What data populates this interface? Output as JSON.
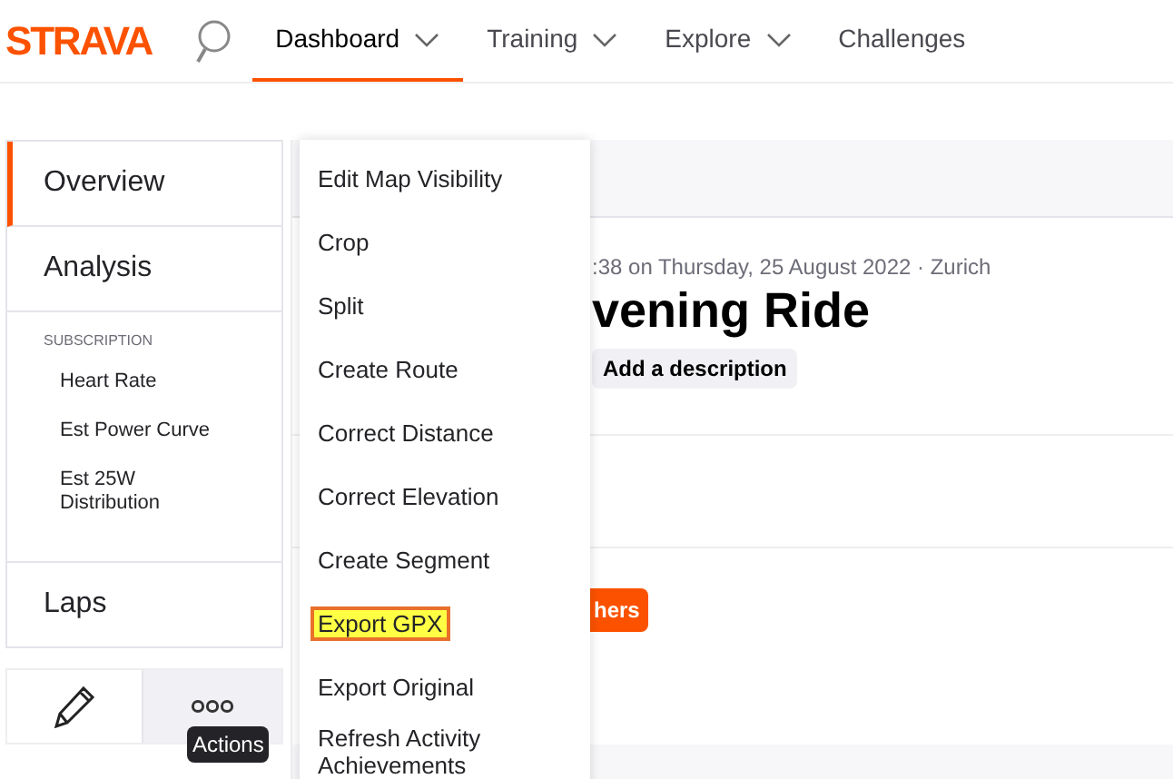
{
  "header": {
    "logo": "STRAVA",
    "nav": [
      {
        "label": "Dashboard",
        "selected": true,
        "dropdown": true
      },
      {
        "label": "Training",
        "selected": false,
        "dropdown": true
      },
      {
        "label": "Explore",
        "selected": false,
        "dropdown": true
      },
      {
        "label": "Challenges",
        "selected": false,
        "dropdown": false
      }
    ]
  },
  "sidebar": {
    "tabs": [
      {
        "label": "Overview",
        "selected": true
      },
      {
        "label": "Analysis",
        "selected": false
      }
    ],
    "section_title": "SUBSCRIPTION",
    "sub_items": [
      "Heart Rate",
      "Est Power Curve",
      "Est 25W Distribution"
    ],
    "laps": {
      "label": "Laps",
      "selected": false
    },
    "actions_tooltip": "Actions"
  },
  "actions_menu": [
    {
      "label": "Edit Map Visibility",
      "highlighted": false
    },
    {
      "label": "Crop",
      "highlighted": false
    },
    {
      "label": "Split",
      "highlighted": false
    },
    {
      "label": "Create Route",
      "highlighted": false
    },
    {
      "label": "Correct Distance",
      "highlighted": false
    },
    {
      "label": "Correct Elevation",
      "highlighted": false
    },
    {
      "label": "Create Segment",
      "highlighted": false
    },
    {
      "label": "Export GPX",
      "highlighted": true
    },
    {
      "label": "Export Original",
      "highlighted": false
    },
    {
      "label": "Refresh Activity Achievements",
      "highlighted": false
    }
  ],
  "activity": {
    "date": ":38 on Thursday, 25 August 2022 · Zurich",
    "title": "vening Ride",
    "description_button": "Add a description",
    "orange_button": "hers"
  }
}
